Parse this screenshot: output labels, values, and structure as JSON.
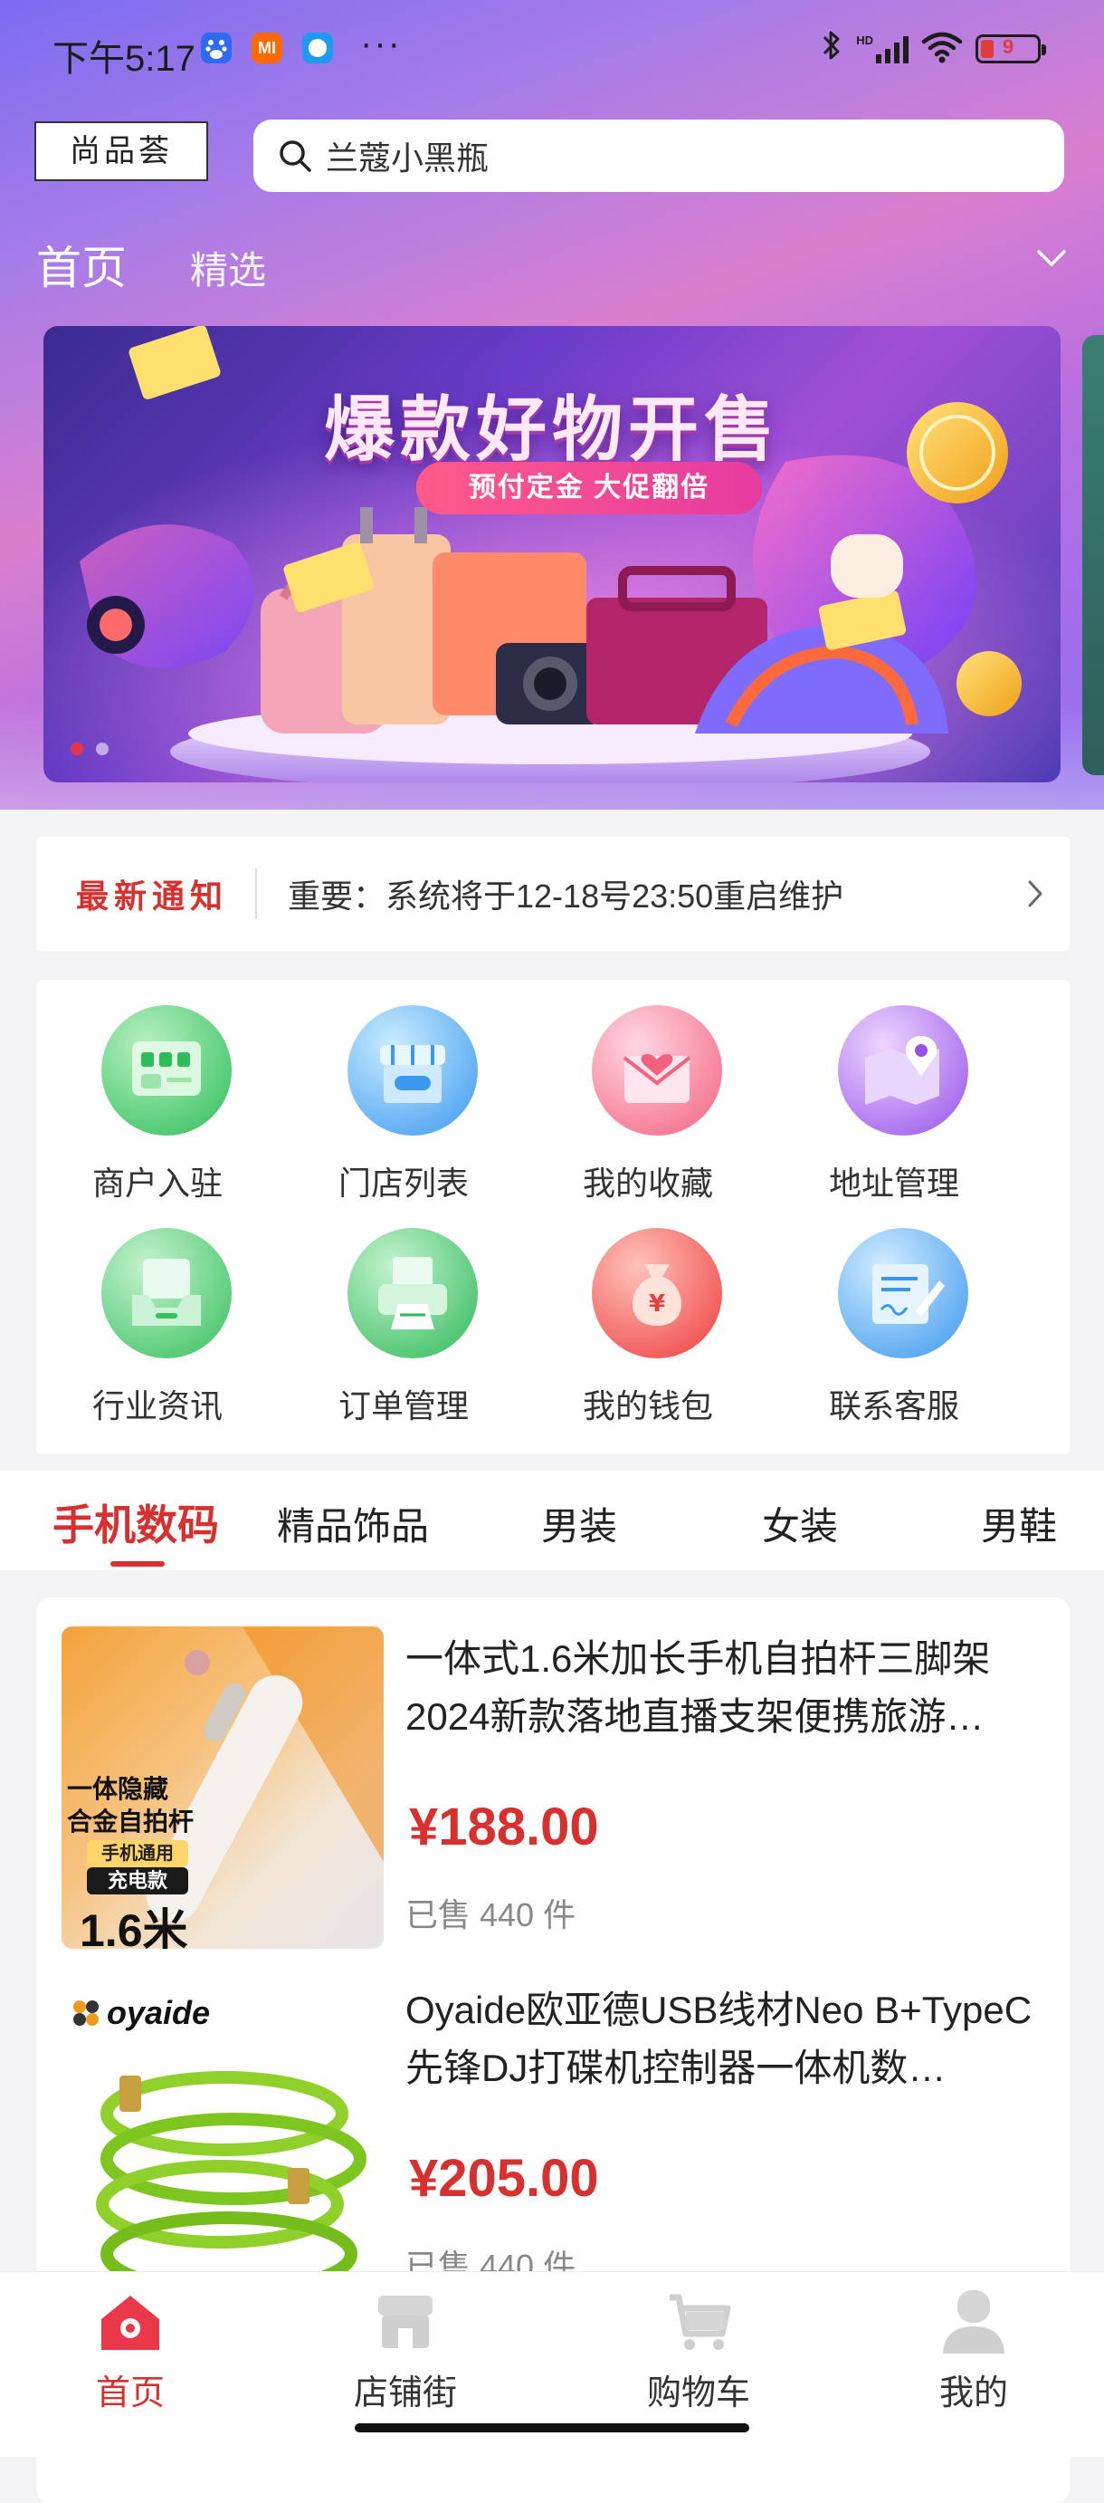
{
  "status_bar": {
    "time": "下午5:17",
    "apps": [
      {
        "icon": "baidu-icon",
        "label": "",
        "color": "#2f6bf0"
      },
      {
        "icon": "mi-icon",
        "label": "MI",
        "color": "#ff6900"
      },
      {
        "icon": "message-app-icon",
        "label": "",
        "color": "#1e9bf0"
      }
    ],
    "more": "···",
    "network": "HD",
    "battery": "9"
  },
  "header": {
    "logo": "尚品荟",
    "search_placeholder": "兰蔻小黑瓶"
  },
  "top_nav": {
    "tabs": [
      "首页",
      "精选"
    ]
  },
  "banner": {
    "title": "爆款好物开售",
    "subtitle": "预付定金 大促翻倍",
    "slides": 2,
    "active_slide": 1
  },
  "notice": {
    "tag": "最新通知",
    "message": "重要：系统将于12-18号23:50重启维护"
  },
  "grid": {
    "items": [
      {
        "label": "商户入驻",
        "icon": "merchant-icon",
        "color1": "#7ee08e",
        "color2": "#2fbd5a"
      },
      {
        "label": "门店列表",
        "icon": "store-icon",
        "color1": "#8fd3ff",
        "color2": "#3a98f0"
      },
      {
        "label": "我的收藏",
        "icon": "envelope-heart-icon",
        "color1": "#ffb3c7",
        "color2": "#f4607f"
      },
      {
        "label": "地址管理",
        "icon": "map-pin-icon",
        "color1": "#d6a6ff",
        "color2": "#9552ea"
      },
      {
        "label": "行业资讯",
        "icon": "inbox-icon",
        "color1": "#8fe3a2",
        "color2": "#36bf5c"
      },
      {
        "label": "订单管理",
        "icon": "printer-order-icon",
        "color1": "#8fe3a2",
        "color2": "#2eb957"
      },
      {
        "label": "我的钱包",
        "icon": "money-bag-icon",
        "color1": "#ff9a8f",
        "color2": "#ee3c3c"
      },
      {
        "label": "联系客服",
        "icon": "form-sign-icon",
        "color1": "#9fd8ff",
        "color2": "#3a97ee"
      }
    ]
  },
  "category_tabs": {
    "tabs": [
      "手机数码",
      "精品饰品",
      "男装",
      "女装",
      "男鞋"
    ],
    "active": 0
  },
  "products": [
    {
      "title": "一体式1.6米加长手机自拍杆三脚架2024新款落地直播支架便携旅游…",
      "price": "¥188.00",
      "sold": "已售 440 件",
      "image_texts": [
        "一体隐藏",
        "合金自拍杆",
        "手机通用",
        "充电款",
        "1.6米"
      ]
    },
    {
      "title": "Oyaide欧亚德USB线材Neo B+TypeC先锋DJ打碟机控制器一体机数…",
      "price": "¥205.00",
      "sold": "已售 440 件",
      "image_texts": [
        "oyaide"
      ]
    }
  ],
  "tab_bar": {
    "items": [
      {
        "label": "首页",
        "icon": "home-icon"
      },
      {
        "label": "店铺街",
        "icon": "shop-icon"
      },
      {
        "label": "购物车",
        "icon": "cart-icon"
      },
      {
        "label": "我的",
        "icon": "user-icon"
      }
    ],
    "active": 0
  },
  "colors": {
    "accent": "#d8302f",
    "hero_gradient": [
      "#7c6cf0",
      "#d97fd0",
      "#8f6ef2"
    ]
  }
}
